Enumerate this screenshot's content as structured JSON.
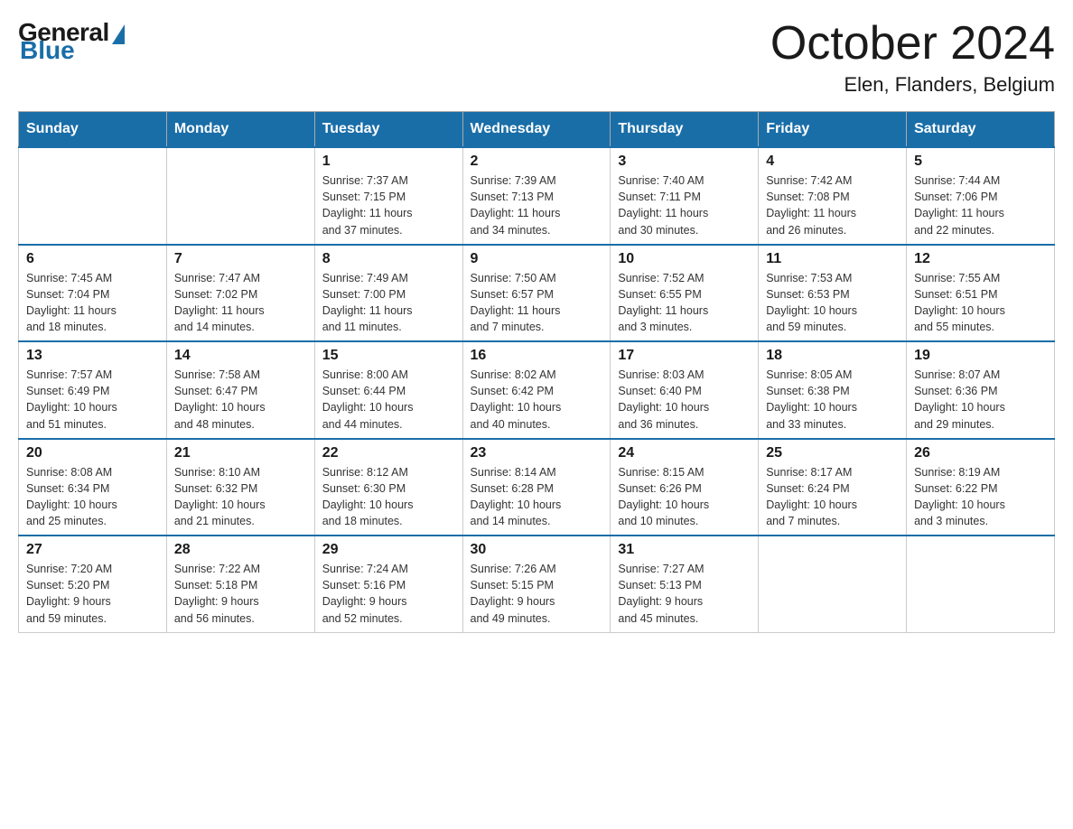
{
  "logo": {
    "general": "General",
    "blue": "Blue"
  },
  "title": {
    "month": "October 2024",
    "location": "Elen, Flanders, Belgium"
  },
  "days_of_week": [
    "Sunday",
    "Monday",
    "Tuesday",
    "Wednesday",
    "Thursday",
    "Friday",
    "Saturday"
  ],
  "weeks": [
    [
      {
        "day": "",
        "info": ""
      },
      {
        "day": "",
        "info": ""
      },
      {
        "day": "1",
        "info": "Sunrise: 7:37 AM\nSunset: 7:15 PM\nDaylight: 11 hours\nand 37 minutes."
      },
      {
        "day": "2",
        "info": "Sunrise: 7:39 AM\nSunset: 7:13 PM\nDaylight: 11 hours\nand 34 minutes."
      },
      {
        "day": "3",
        "info": "Sunrise: 7:40 AM\nSunset: 7:11 PM\nDaylight: 11 hours\nand 30 minutes."
      },
      {
        "day": "4",
        "info": "Sunrise: 7:42 AM\nSunset: 7:08 PM\nDaylight: 11 hours\nand 26 minutes."
      },
      {
        "day": "5",
        "info": "Sunrise: 7:44 AM\nSunset: 7:06 PM\nDaylight: 11 hours\nand 22 minutes."
      }
    ],
    [
      {
        "day": "6",
        "info": "Sunrise: 7:45 AM\nSunset: 7:04 PM\nDaylight: 11 hours\nand 18 minutes."
      },
      {
        "day": "7",
        "info": "Sunrise: 7:47 AM\nSunset: 7:02 PM\nDaylight: 11 hours\nand 14 minutes."
      },
      {
        "day": "8",
        "info": "Sunrise: 7:49 AM\nSunset: 7:00 PM\nDaylight: 11 hours\nand 11 minutes."
      },
      {
        "day": "9",
        "info": "Sunrise: 7:50 AM\nSunset: 6:57 PM\nDaylight: 11 hours\nand 7 minutes."
      },
      {
        "day": "10",
        "info": "Sunrise: 7:52 AM\nSunset: 6:55 PM\nDaylight: 11 hours\nand 3 minutes."
      },
      {
        "day": "11",
        "info": "Sunrise: 7:53 AM\nSunset: 6:53 PM\nDaylight: 10 hours\nand 59 minutes."
      },
      {
        "day": "12",
        "info": "Sunrise: 7:55 AM\nSunset: 6:51 PM\nDaylight: 10 hours\nand 55 minutes."
      }
    ],
    [
      {
        "day": "13",
        "info": "Sunrise: 7:57 AM\nSunset: 6:49 PM\nDaylight: 10 hours\nand 51 minutes."
      },
      {
        "day": "14",
        "info": "Sunrise: 7:58 AM\nSunset: 6:47 PM\nDaylight: 10 hours\nand 48 minutes."
      },
      {
        "day": "15",
        "info": "Sunrise: 8:00 AM\nSunset: 6:44 PM\nDaylight: 10 hours\nand 44 minutes."
      },
      {
        "day": "16",
        "info": "Sunrise: 8:02 AM\nSunset: 6:42 PM\nDaylight: 10 hours\nand 40 minutes."
      },
      {
        "day": "17",
        "info": "Sunrise: 8:03 AM\nSunset: 6:40 PM\nDaylight: 10 hours\nand 36 minutes."
      },
      {
        "day": "18",
        "info": "Sunrise: 8:05 AM\nSunset: 6:38 PM\nDaylight: 10 hours\nand 33 minutes."
      },
      {
        "day": "19",
        "info": "Sunrise: 8:07 AM\nSunset: 6:36 PM\nDaylight: 10 hours\nand 29 minutes."
      }
    ],
    [
      {
        "day": "20",
        "info": "Sunrise: 8:08 AM\nSunset: 6:34 PM\nDaylight: 10 hours\nand 25 minutes."
      },
      {
        "day": "21",
        "info": "Sunrise: 8:10 AM\nSunset: 6:32 PM\nDaylight: 10 hours\nand 21 minutes."
      },
      {
        "day": "22",
        "info": "Sunrise: 8:12 AM\nSunset: 6:30 PM\nDaylight: 10 hours\nand 18 minutes."
      },
      {
        "day": "23",
        "info": "Sunrise: 8:14 AM\nSunset: 6:28 PM\nDaylight: 10 hours\nand 14 minutes."
      },
      {
        "day": "24",
        "info": "Sunrise: 8:15 AM\nSunset: 6:26 PM\nDaylight: 10 hours\nand 10 minutes."
      },
      {
        "day": "25",
        "info": "Sunrise: 8:17 AM\nSunset: 6:24 PM\nDaylight: 10 hours\nand 7 minutes."
      },
      {
        "day": "26",
        "info": "Sunrise: 8:19 AM\nSunset: 6:22 PM\nDaylight: 10 hours\nand 3 minutes."
      }
    ],
    [
      {
        "day": "27",
        "info": "Sunrise: 7:20 AM\nSunset: 5:20 PM\nDaylight: 9 hours\nand 59 minutes."
      },
      {
        "day": "28",
        "info": "Sunrise: 7:22 AM\nSunset: 5:18 PM\nDaylight: 9 hours\nand 56 minutes."
      },
      {
        "day": "29",
        "info": "Sunrise: 7:24 AM\nSunset: 5:16 PM\nDaylight: 9 hours\nand 52 minutes."
      },
      {
        "day": "30",
        "info": "Sunrise: 7:26 AM\nSunset: 5:15 PM\nDaylight: 9 hours\nand 49 minutes."
      },
      {
        "day": "31",
        "info": "Sunrise: 7:27 AM\nSunset: 5:13 PM\nDaylight: 9 hours\nand 45 minutes."
      },
      {
        "day": "",
        "info": ""
      },
      {
        "day": "",
        "info": ""
      }
    ]
  ]
}
